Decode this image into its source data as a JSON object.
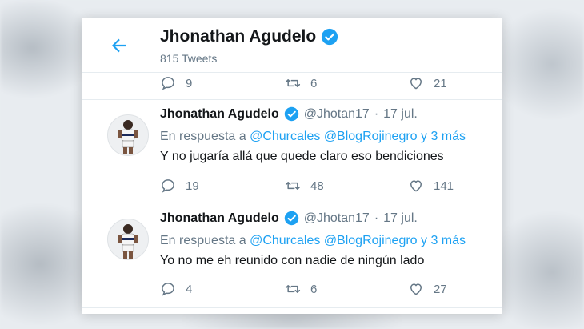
{
  "header": {
    "name": "Jhonathan Agudelo",
    "tweet_count": "815 Tweets"
  },
  "top_actions": {
    "replies": "9",
    "retweets": "6",
    "likes": "21"
  },
  "tweets": [
    {
      "name": "Jhonathan Agudelo",
      "handle": "@Jhotan17",
      "dot": "·",
      "date": "17 jul.",
      "reply_prefix": "En respuesta a",
      "reply_user1": "@Churcales",
      "reply_user2": "@BlogRojinegro",
      "reply_more": "y 3 más",
      "text": "Y no jugaría allá que quede claro eso bendiciones",
      "replies": "19",
      "retweets": "48",
      "likes": "141"
    },
    {
      "name": "Jhonathan Agudelo",
      "handle": "@Jhotan17",
      "dot": "·",
      "date": "17 jul.",
      "reply_prefix": "En respuesta a",
      "reply_user1": "@Churcales",
      "reply_user2": "@BlogRojinegro",
      "reply_more": "y 3 más",
      "text": "Yo no me eh reunido con nadie de ningún lado",
      "replies": "4",
      "retweets": "6",
      "likes": "27"
    }
  ],
  "colors": {
    "accent": "#1da1f2",
    "verified": "#1da1f2",
    "secondary_text": "#657786"
  }
}
